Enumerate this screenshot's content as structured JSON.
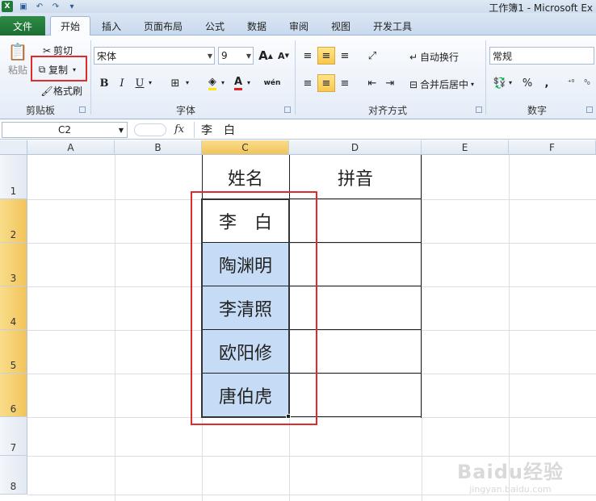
{
  "window": {
    "title": "工作簿1 - Microsoft Ex"
  },
  "tabs": [
    {
      "label": "文件"
    },
    {
      "label": "开始"
    },
    {
      "label": "插入"
    },
    {
      "label": "页面布局"
    },
    {
      "label": "公式"
    },
    {
      "label": "数据"
    },
    {
      "label": "审阅"
    },
    {
      "label": "视图"
    },
    {
      "label": "开发工具"
    }
  ],
  "ribbon": {
    "clipboard": {
      "paste": "粘贴",
      "cut": "剪切",
      "copy": "复制",
      "format_painter": "格式刷",
      "label": "剪贴板"
    },
    "font": {
      "name": "宋体",
      "size": "9",
      "label": "字体",
      "bold": "B",
      "italic": "I",
      "underline": "U",
      "wen": "wén",
      "grow": "A",
      "shrink": "A"
    },
    "alignment": {
      "wrap": "自动换行",
      "merge": "合并后居中",
      "label": "对齐方式"
    },
    "number": {
      "format": "常规",
      "label": "数字",
      "percent": "%",
      "comma": ","
    }
  },
  "formula_bar": {
    "name_box": "C2",
    "fx": "fx",
    "value": "李　白"
  },
  "columns": [
    "A",
    "B",
    "C",
    "D",
    "E",
    "F"
  ],
  "rows": [
    "1",
    "2",
    "3",
    "4",
    "5",
    "6",
    "7",
    "8"
  ],
  "cells": {
    "C1": "姓名",
    "D1": "拼音",
    "C2": "李　白",
    "C3": "陶渊明",
    "C4": "李清照",
    "C5": "欧阳修",
    "C6": "唐伯虎"
  },
  "watermark": {
    "main": "Baidu经验",
    "sub": "jingyan.baidu.com"
  },
  "colors": {
    "accent_red": "#e12b2b",
    "selection_blue": "#c6dcf6",
    "file_tab_green": "#1f7a3a",
    "header_selected": "#f2c45a"
  }
}
